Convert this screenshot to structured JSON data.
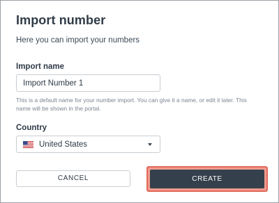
{
  "dialog": {
    "title": "Import number",
    "subtitle": "Here you can import your numbers"
  },
  "import_name": {
    "label": "Import name",
    "value": "Import Number 1",
    "help": "This is a default name for your number import. You can give it a name, or edit it later. This name will be shown in the portal."
  },
  "country": {
    "label": "Country",
    "selected": "United States",
    "flag_icon": "us-flag-icon"
  },
  "actions": {
    "cancel_label": "CANCEL",
    "create_label": "CREATE"
  },
  "colors": {
    "primary_button": "#34404c",
    "highlight": "#f09a8e",
    "highlight_border": "#e06a5a"
  }
}
